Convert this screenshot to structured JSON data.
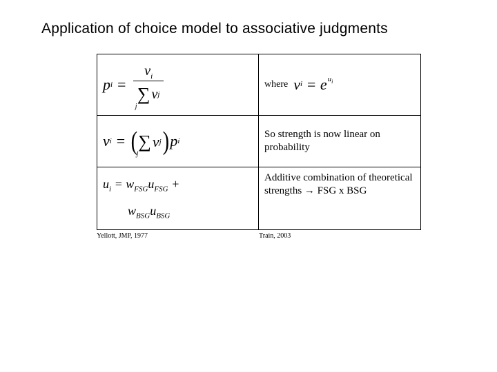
{
  "title": "Application of choice model to associative judgments",
  "rows": {
    "r1": {
      "right_where": "where",
      "pi": "p",
      "pi_sub": "i",
      "vi": "v",
      "vi_sub": "i",
      "vj": "v",
      "vj_sub": "j",
      "e": "e",
      "u": "u",
      "ui_sub": "i"
    },
    "r2": {
      "right": "So strength is now linear on probability"
    },
    "r3": {
      "right": "Additive combination of theoretical strengths → FSG x BSG",
      "u": "u",
      "i": "i",
      "w": "w",
      "FSG": "FSG",
      "BSG": "BSG",
      "plus": "+"
    }
  },
  "citations": {
    "left": "Yellott, JMP, 1977",
    "right": "Train, 2003"
  }
}
